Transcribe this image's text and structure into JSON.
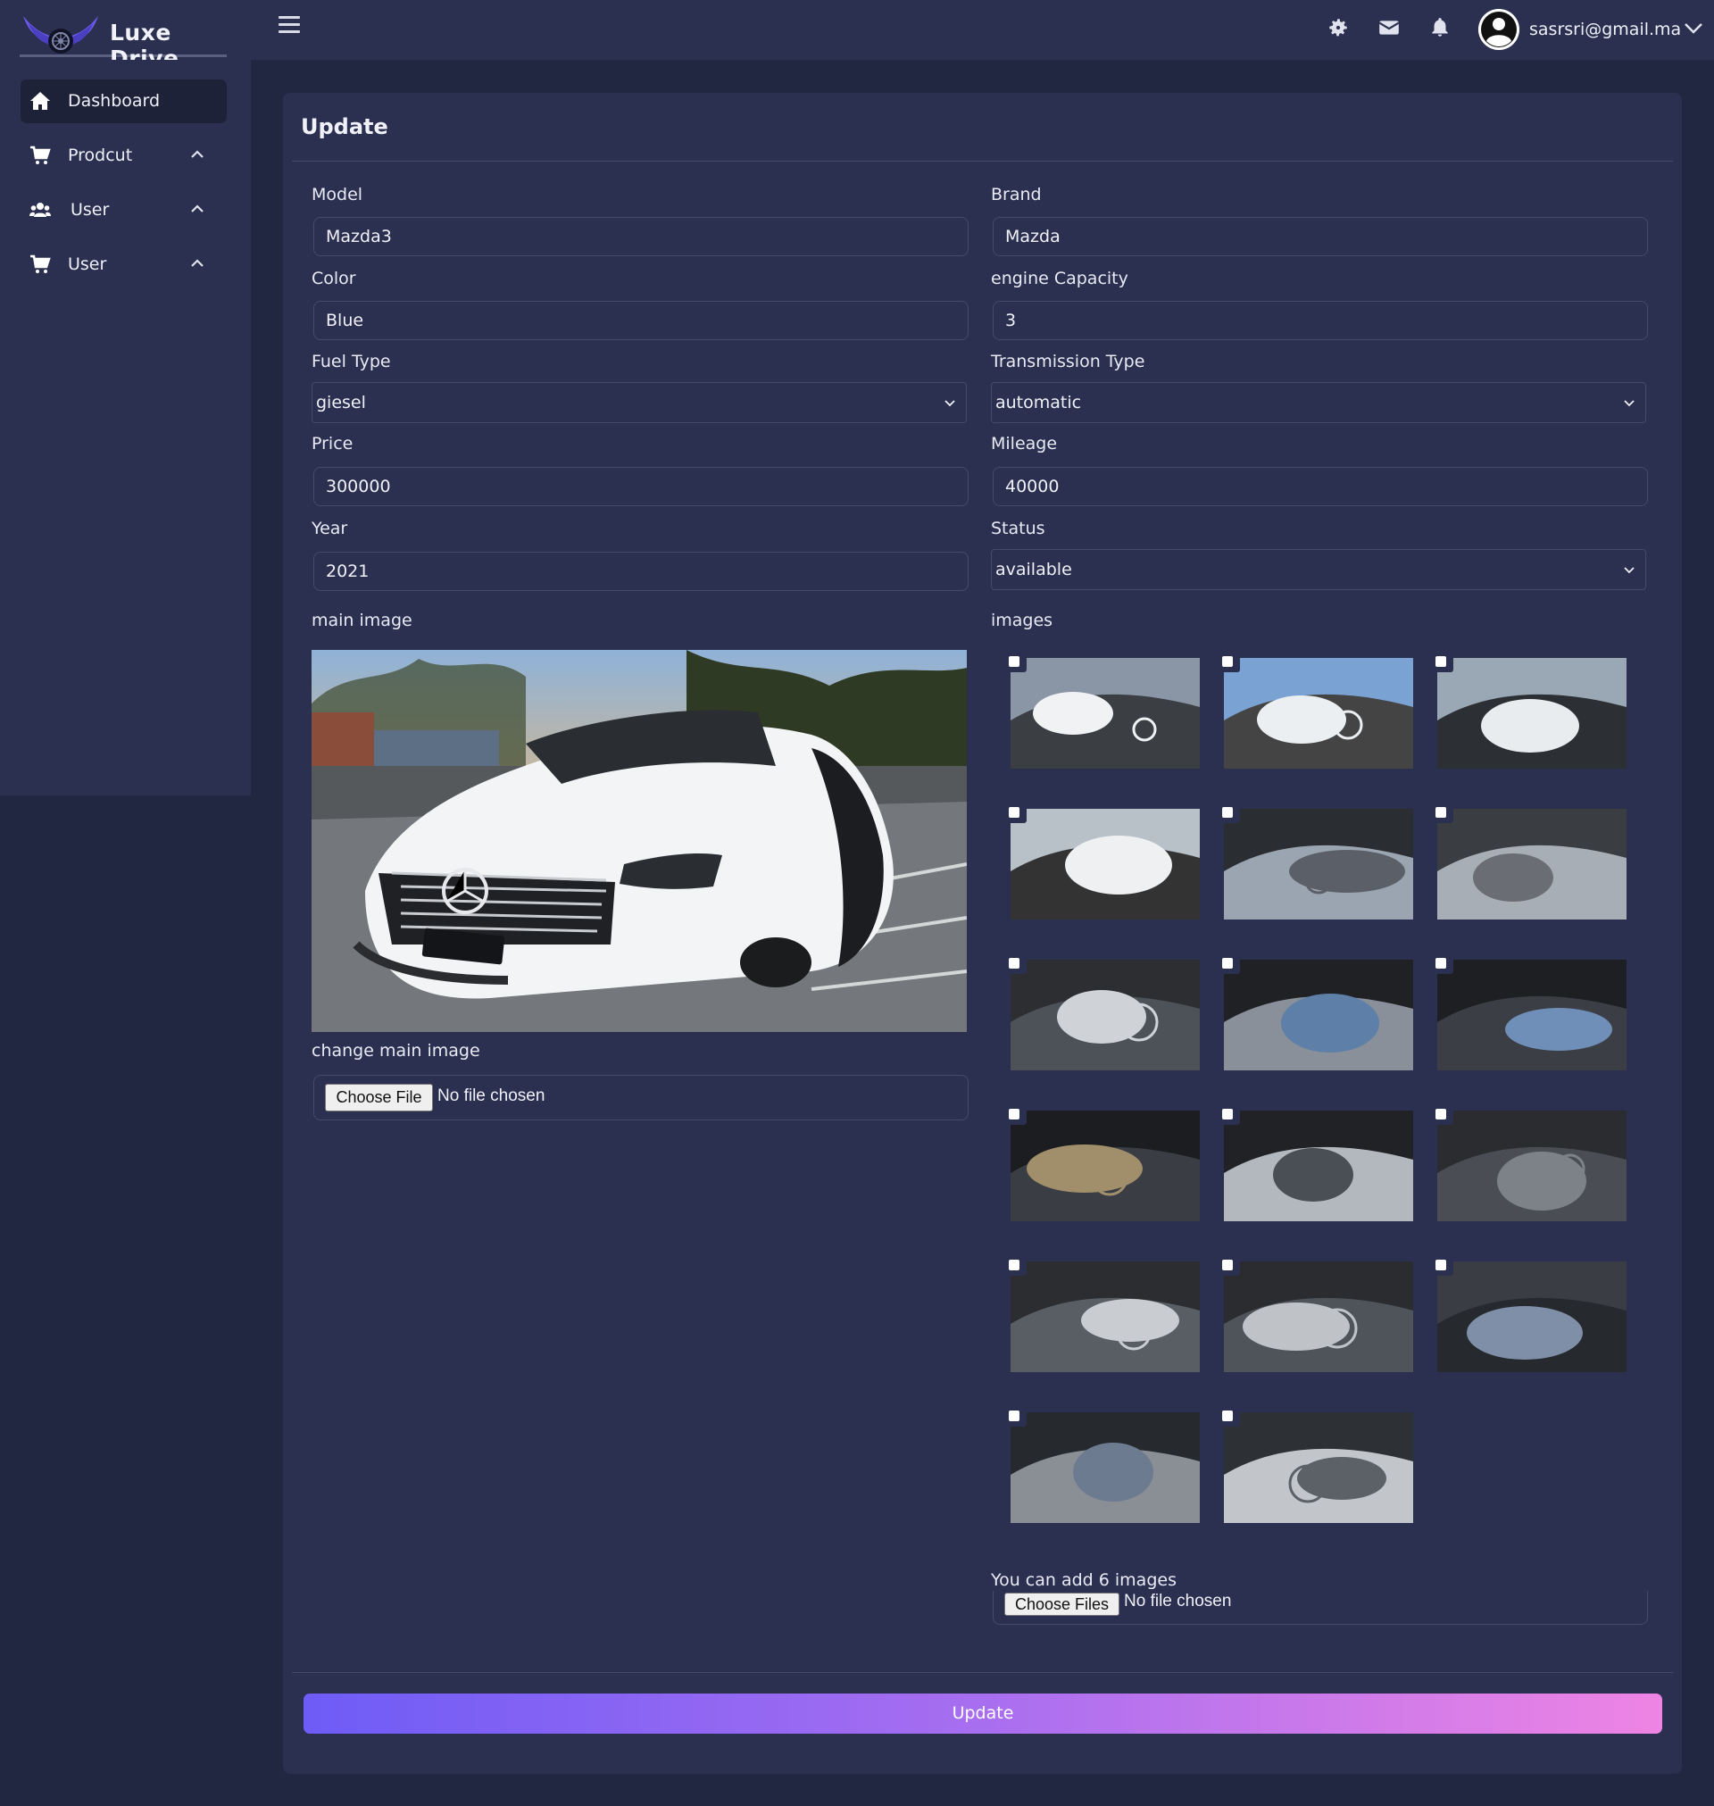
{
  "app": {
    "brand": "Luxe Drive",
    "user_email": "sasrsri@gmail.ma"
  },
  "sidebar": {
    "items": [
      {
        "label": "Dashboard",
        "icon": "home-icon",
        "active": true
      },
      {
        "label": "Prodcut",
        "icon": "cart-icon"
      },
      {
        "label": "User",
        "icon": "users-icon"
      },
      {
        "label": "User",
        "icon": "cart-icon"
      }
    ]
  },
  "form": {
    "title": "Update",
    "model": {
      "label": "Model",
      "value": "Mazda3"
    },
    "brand": {
      "label": "Brand",
      "value": "Mazda"
    },
    "color": {
      "label": "Color",
      "value": "Blue"
    },
    "engine_capacity": {
      "label": "engine Capacity",
      "value": "3"
    },
    "fuel_type": {
      "label": "Fuel Type",
      "value": "giesel"
    },
    "transmission_type": {
      "label": "Transmission Type",
      "value": "automatic"
    },
    "price": {
      "label": "Price",
      "value": "300000"
    },
    "mileage": {
      "label": "Mileage",
      "value": "40000"
    },
    "year": {
      "label": "Year",
      "value": "2021"
    },
    "status": {
      "label": "Status",
      "value": "available"
    },
    "main_image_label": "main image",
    "images_label": "images",
    "change_main_image_label": "change main image",
    "main_file": {
      "button": "Choose File",
      "status": "No file chosen"
    },
    "images_hint": "You can add 6 images",
    "images_file": {
      "button": "Choose Files",
      "status": "No file chosen"
    },
    "submit": "Update",
    "thumbnail_count": 17
  },
  "colors": {
    "background": "#222741",
    "panel": "#2b3050",
    "border": "#454a6a",
    "gradient_start": "#6e5cf6",
    "gradient_end": "#ee84e4"
  }
}
